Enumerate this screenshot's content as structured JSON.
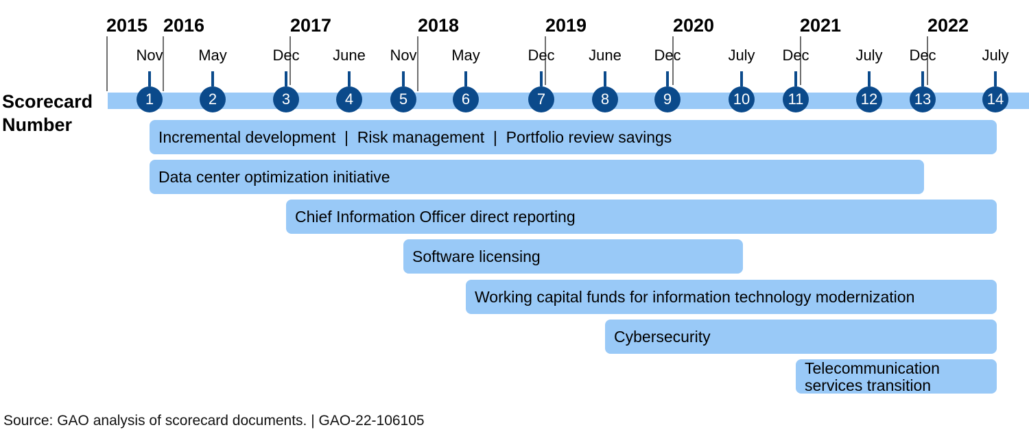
{
  "axis_label": [
    "Scorecard",
    "Number"
  ],
  "years": [
    "2015",
    "2016",
    "2017",
    "2018",
    "2019",
    "2020",
    "2021",
    "2022"
  ],
  "scorecards": [
    {
      "number": "1",
      "month": "Nov"
    },
    {
      "number": "2",
      "month": "May"
    },
    {
      "number": "3",
      "month": "Dec"
    },
    {
      "number": "4",
      "month": "June"
    },
    {
      "number": "5",
      "month": "Nov"
    },
    {
      "number": "6",
      "month": "May"
    },
    {
      "number": "7",
      "month": "Dec"
    },
    {
      "number": "8",
      "month": "June"
    },
    {
      "number": "9",
      "month": "Dec"
    },
    {
      "number": "10",
      "month": "July"
    },
    {
      "number": "11",
      "month": "Dec"
    },
    {
      "number": "12",
      "month": "July"
    },
    {
      "number": "13",
      "month": "Dec"
    },
    {
      "number": "14",
      "month": "July"
    }
  ],
  "categories": [
    {
      "label": "Incremental development  |  Risk management  |  Portfolio review savings",
      "start_scorecard": 1,
      "end_scorecard": 14
    },
    {
      "label": "Data center optimization initiative",
      "start_scorecard": 1,
      "end_scorecard": 13
    },
    {
      "label": "Chief Information Officer direct reporting",
      "start_scorecard": 3,
      "end_scorecard": 14
    },
    {
      "label": "Software licensing",
      "start_scorecard": 5,
      "end_scorecard": 10
    },
    {
      "label": "Working capital funds for information technology modernization",
      "start_scorecard": 6,
      "end_scorecard": 14
    },
    {
      "label": "Cybersecurity",
      "start_scorecard": 8,
      "end_scorecard": 14
    },
    {
      "label": [
        "Telecommunication",
        "services transition"
      ],
      "start_scorecard": 11,
      "end_scorecard": 14
    }
  ],
  "source": "Source: GAO analysis of scorecard documents.  |  GAO-22-106105",
  "colors": {
    "circle": "#0b4a8b",
    "band": "#99c9f7",
    "bar": "#99c9f7",
    "year_line": "#6e6e6e"
  }
}
